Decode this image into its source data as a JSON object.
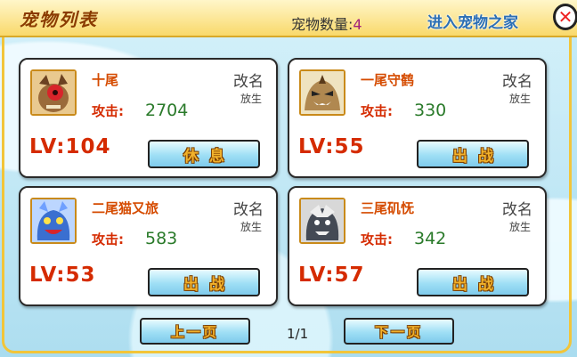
{
  "header": {
    "title": "宠物列表",
    "pet_count_label": "宠物数量:",
    "pet_count_value": "4",
    "enter_home_label": "进入宠物之家",
    "close_icon": "close-icon"
  },
  "pets": [
    {
      "name": "十尾",
      "attack_label": "攻击:",
      "attack": "2704",
      "level": "LV:104",
      "rename_label": "改名",
      "release_label": "放生",
      "action_label": "休息",
      "avatar_color": "#9a6a3a",
      "avatar_icon": "ten-tails-avatar-icon"
    },
    {
      "name": "一尾守鹤",
      "attack_label": "攻击:",
      "attack": "330",
      "level": "LV:55",
      "rename_label": "改名",
      "release_label": "放生",
      "action_label": "出战",
      "avatar_color": "#b08850",
      "avatar_icon": "one-tail-avatar-icon"
    },
    {
      "name": "二尾猫又旅",
      "attack_label": "攻击:",
      "attack": "583",
      "level": "LV:53",
      "rename_label": "改名",
      "release_label": "放生",
      "action_label": "出战",
      "avatar_color": "#3a6fd0",
      "avatar_icon": "two-tails-avatar-icon"
    },
    {
      "name": "三尾矶怃",
      "attack_label": "攻击:",
      "attack": "342",
      "level": "LV:57",
      "rename_label": "改名",
      "release_label": "放生",
      "action_label": "出战",
      "avatar_color": "#444a55",
      "avatar_icon": "three-tails-avatar-icon"
    }
  ],
  "pagination": {
    "prev_label": "上一页",
    "next_label": "下一页",
    "indicator": "1/1"
  }
}
